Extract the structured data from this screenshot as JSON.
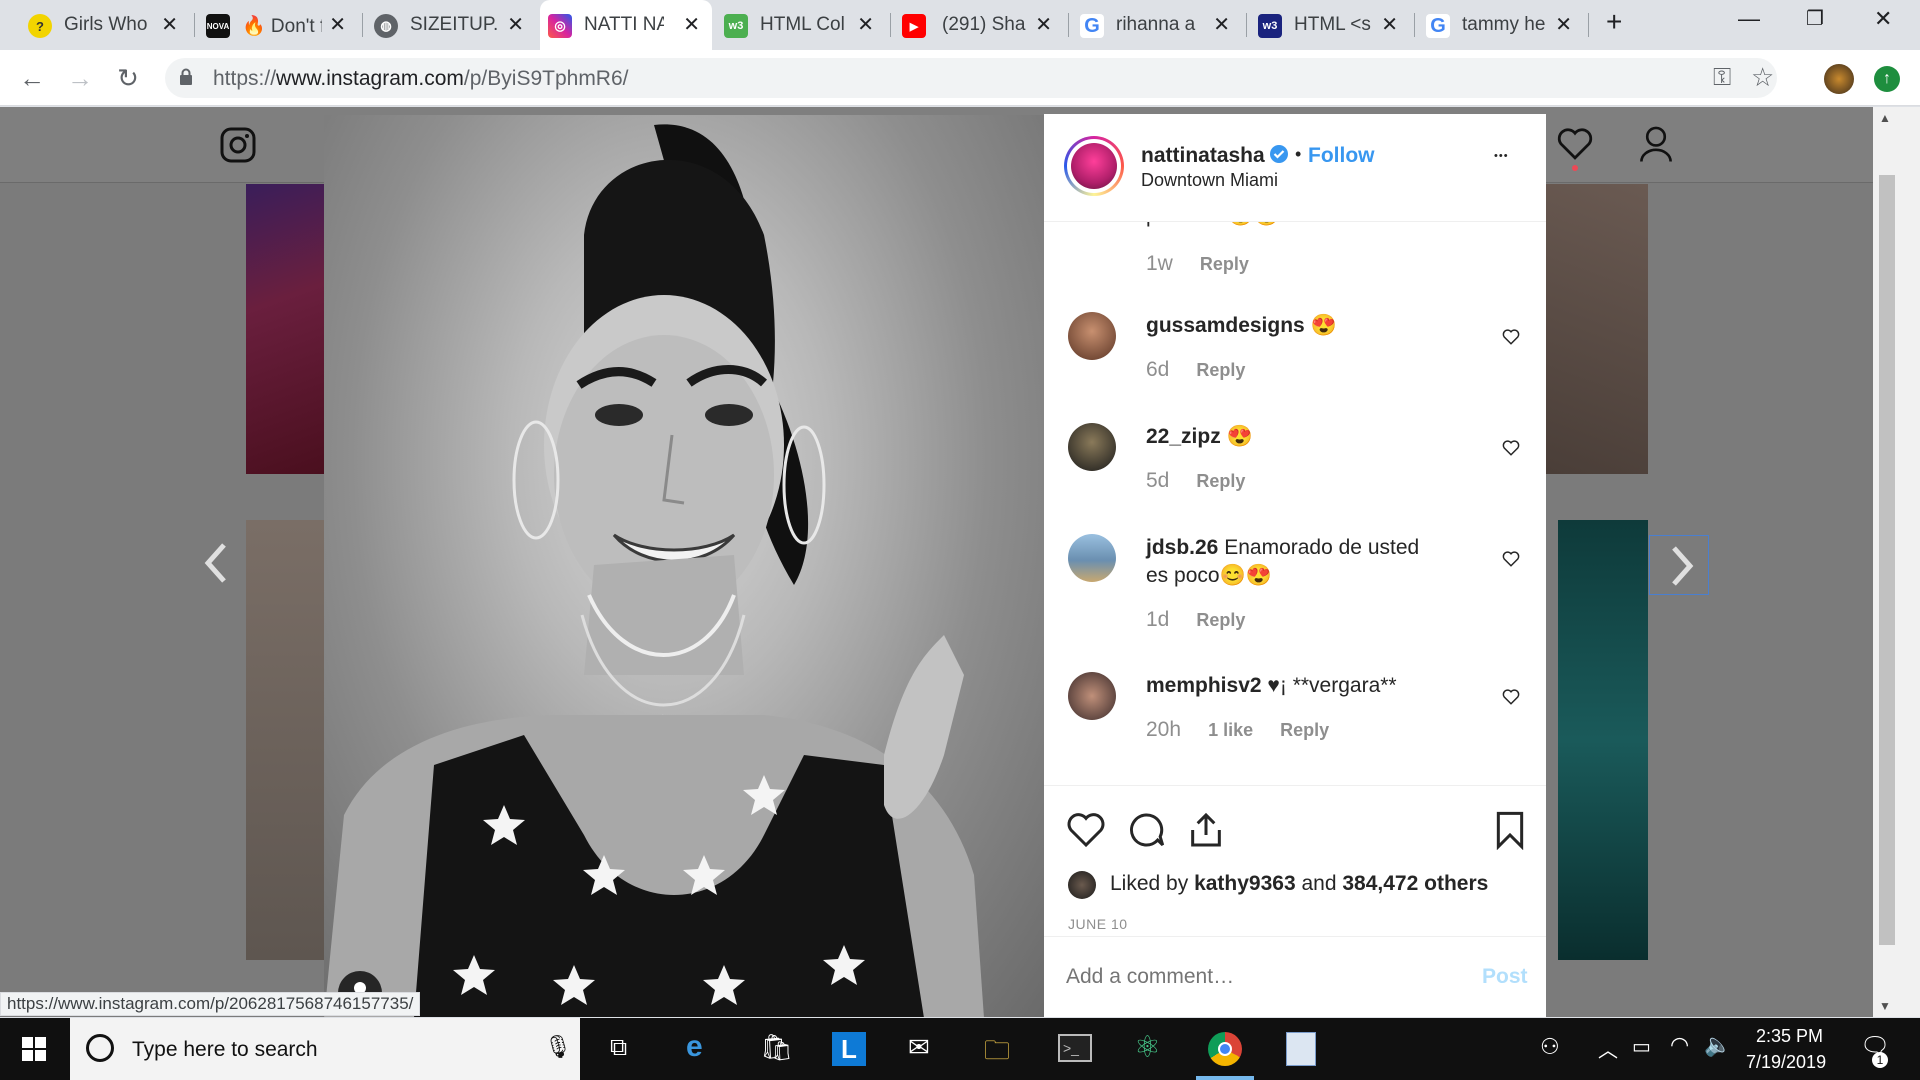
{
  "browser": {
    "tabs": [
      {
        "title": "Girls Who",
        "favicon_color": "#f2d400",
        "active": false
      },
      {
        "title": "🔥 Don't f",
        "favicon_color": "#111111",
        "active": false
      },
      {
        "title": "SIZEITUP.",
        "favicon_color": "#5f6368",
        "active": false
      },
      {
        "title": "NATTI NA",
        "favicon_color": "#c13584",
        "active": true
      },
      {
        "title": "HTML Col",
        "favicon_color": "#4caf50",
        "active": false
      },
      {
        "title": "(291) Sha",
        "favicon_color": "#ff0000",
        "active": false
      },
      {
        "title": "rihanna a",
        "favicon_color": "#4285f4",
        "active": false
      },
      {
        "title": "HTML <s",
        "favicon_color": "#1a237e",
        "active": false
      },
      {
        "title": "tammy he",
        "favicon_color": "#4285f4",
        "active": false
      }
    ],
    "url_prefix": "https://",
    "url_host": "www.instagram.com",
    "url_path": "/p/ByiS9TphmR6/",
    "new_tab": "+"
  },
  "post": {
    "username": "nattinatasha",
    "follow_label": "Follow",
    "separator": "•",
    "location": "Downtown Miami",
    "more": "•••",
    "partial_comment": "perfecta 😍😍",
    "partial_age": "1w",
    "comments": [
      {
        "user": "gussamdesigns",
        "text": "😍",
        "age": "6d",
        "likes": "",
        "avatar_color": "#8a5a44"
      },
      {
        "user": "22_zipz",
        "text": "😍",
        "age": "5d",
        "likes": "",
        "avatar_color": "#3b3b3b"
      },
      {
        "user": "jdsb.26",
        "text": "Enamorado de usted es poco😊😍",
        "age": "1d",
        "likes": "",
        "avatar_color": "#6a8fb0"
      },
      {
        "user": "memphisv2",
        "text": "♥¡ **vergara**",
        "age": "20h",
        "likes": "1 like",
        "avatar_color": "#7a5a4a"
      }
    ],
    "reply_label": "Reply",
    "liked_by_prefix": "Liked by",
    "liked_by_user": "kathy9363",
    "liked_by_and": "and",
    "liked_by_count": "384,472 others",
    "date": "JUNE 10",
    "comment_placeholder": "Add a comment…",
    "post_label": "Post"
  },
  "status_link": "https://www.instagram.com/p/2062817568746157735/",
  "taskbar": {
    "search_placeholder": "Type here to search",
    "time": "2:35 PM",
    "date": "7/19/2019",
    "notification_count": "1"
  }
}
